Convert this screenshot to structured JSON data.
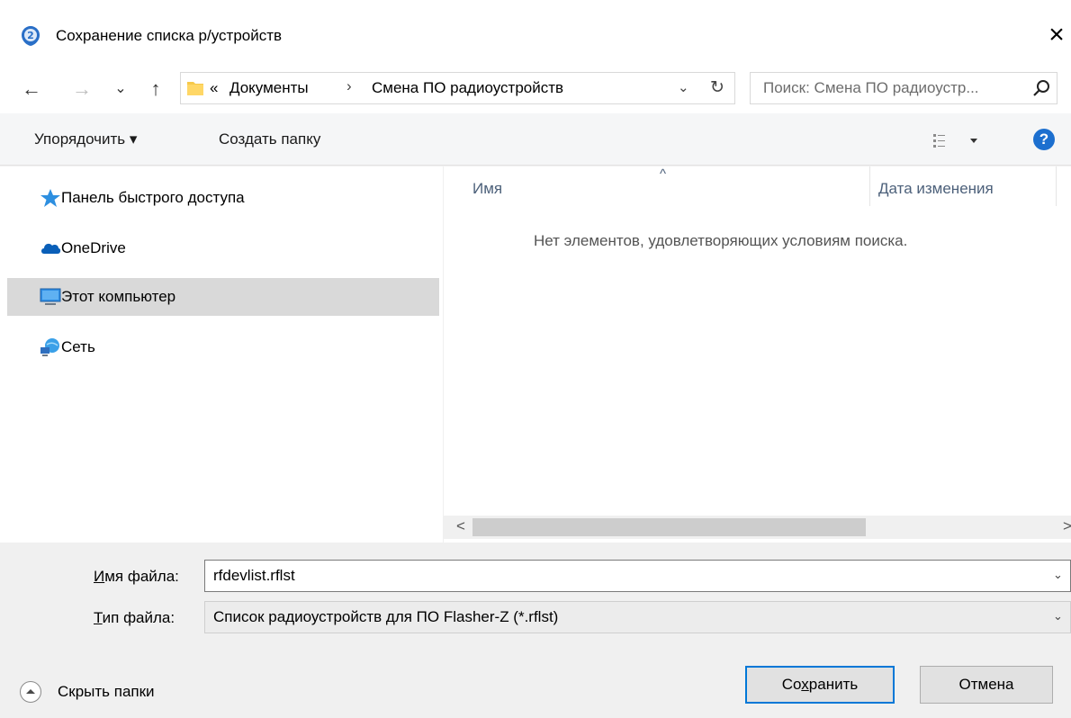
{
  "window": {
    "title": "Сохранение списка р/устройств",
    "close_label": "×"
  },
  "nav": {
    "back": "←",
    "forward": "→",
    "recent": "⌄",
    "up": "↑"
  },
  "address": {
    "overflow": "«",
    "crumbs": [
      "Документы",
      "Смена ПО радиоустройств"
    ],
    "separator": "›",
    "dropdown": "⌄",
    "refresh": "↻"
  },
  "search": {
    "placeholder": "Поиск: Смена ПО радиоустр..."
  },
  "toolbar": {
    "organize": "Упорядочить ▾",
    "new_folder": "Создать папку",
    "help": "?"
  },
  "sidebar": {
    "items": [
      {
        "label": "Панель быстрого доступа",
        "icon": "star-icon",
        "selected": false
      },
      {
        "label": "OneDrive",
        "icon": "cloud-icon",
        "selected": false
      },
      {
        "label": "Этот компьютер",
        "icon": "computer-icon",
        "selected": true
      },
      {
        "label": "Сеть",
        "icon": "network-icon",
        "selected": false
      }
    ]
  },
  "files": {
    "columns": [
      "Имя",
      "Дата изменения"
    ],
    "sort_caret": "^",
    "empty_message": "Нет элементов, удовлетворяющих условиям поиска.",
    "scroll_left": "<",
    "scroll_right": ">"
  },
  "form": {
    "filename": {
      "label_accel": "И",
      "label_rest": "мя файла:",
      "value": "rfdevlist.rflst"
    },
    "filetype": {
      "label_accel": "Т",
      "label_rest": "ип файла:",
      "value": "Список радиоустройств для ПО Flasher-Z (*.rflst)"
    },
    "chevron": "⌄"
  },
  "footer": {
    "hide_folders": "Скрыть папки",
    "save_pre": "Со",
    "save_accel": "х",
    "save_post": "ранить",
    "cancel": "Отмена"
  },
  "colors": {
    "accent": "#0078d7",
    "selected_bg": "#d9d9d9",
    "help_blue": "#1c6fcf"
  }
}
